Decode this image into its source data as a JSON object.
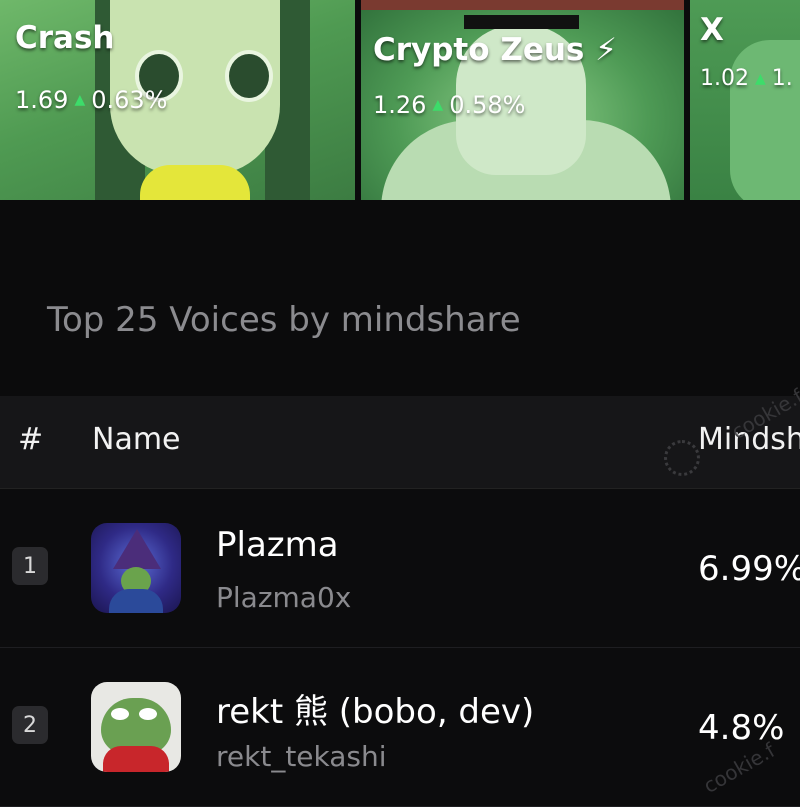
{
  "tiles": [
    {
      "name": "Crash",
      "value": "1.69",
      "change": "0.63%"
    },
    {
      "name": "Crypto Zeus ⚡",
      "value": "1.26",
      "change": "0.58%"
    },
    {
      "name": "X",
      "value": "1.02",
      "change": "1."
    }
  ],
  "section": {
    "title": "Top 25 Voices by mindshare"
  },
  "table": {
    "headers": {
      "rank": "#",
      "name": "Name",
      "mindshare": "Mindsh"
    },
    "rows": [
      {
        "rank": "1",
        "name": "Plazma",
        "handle": "Plazma0x",
        "mindshare": "6.99%"
      },
      {
        "rank": "2",
        "name": "rekt 熊 (bobo, dev)",
        "handle": "rekt_tekashi",
        "mindshare": "4.8%"
      }
    ]
  },
  "watermark": {
    "text": "cookie.f"
  },
  "colors": {
    "background": "#0b0b0c",
    "accent_up": "#3ddc6a",
    "muted_text": "#8b8b8f"
  }
}
